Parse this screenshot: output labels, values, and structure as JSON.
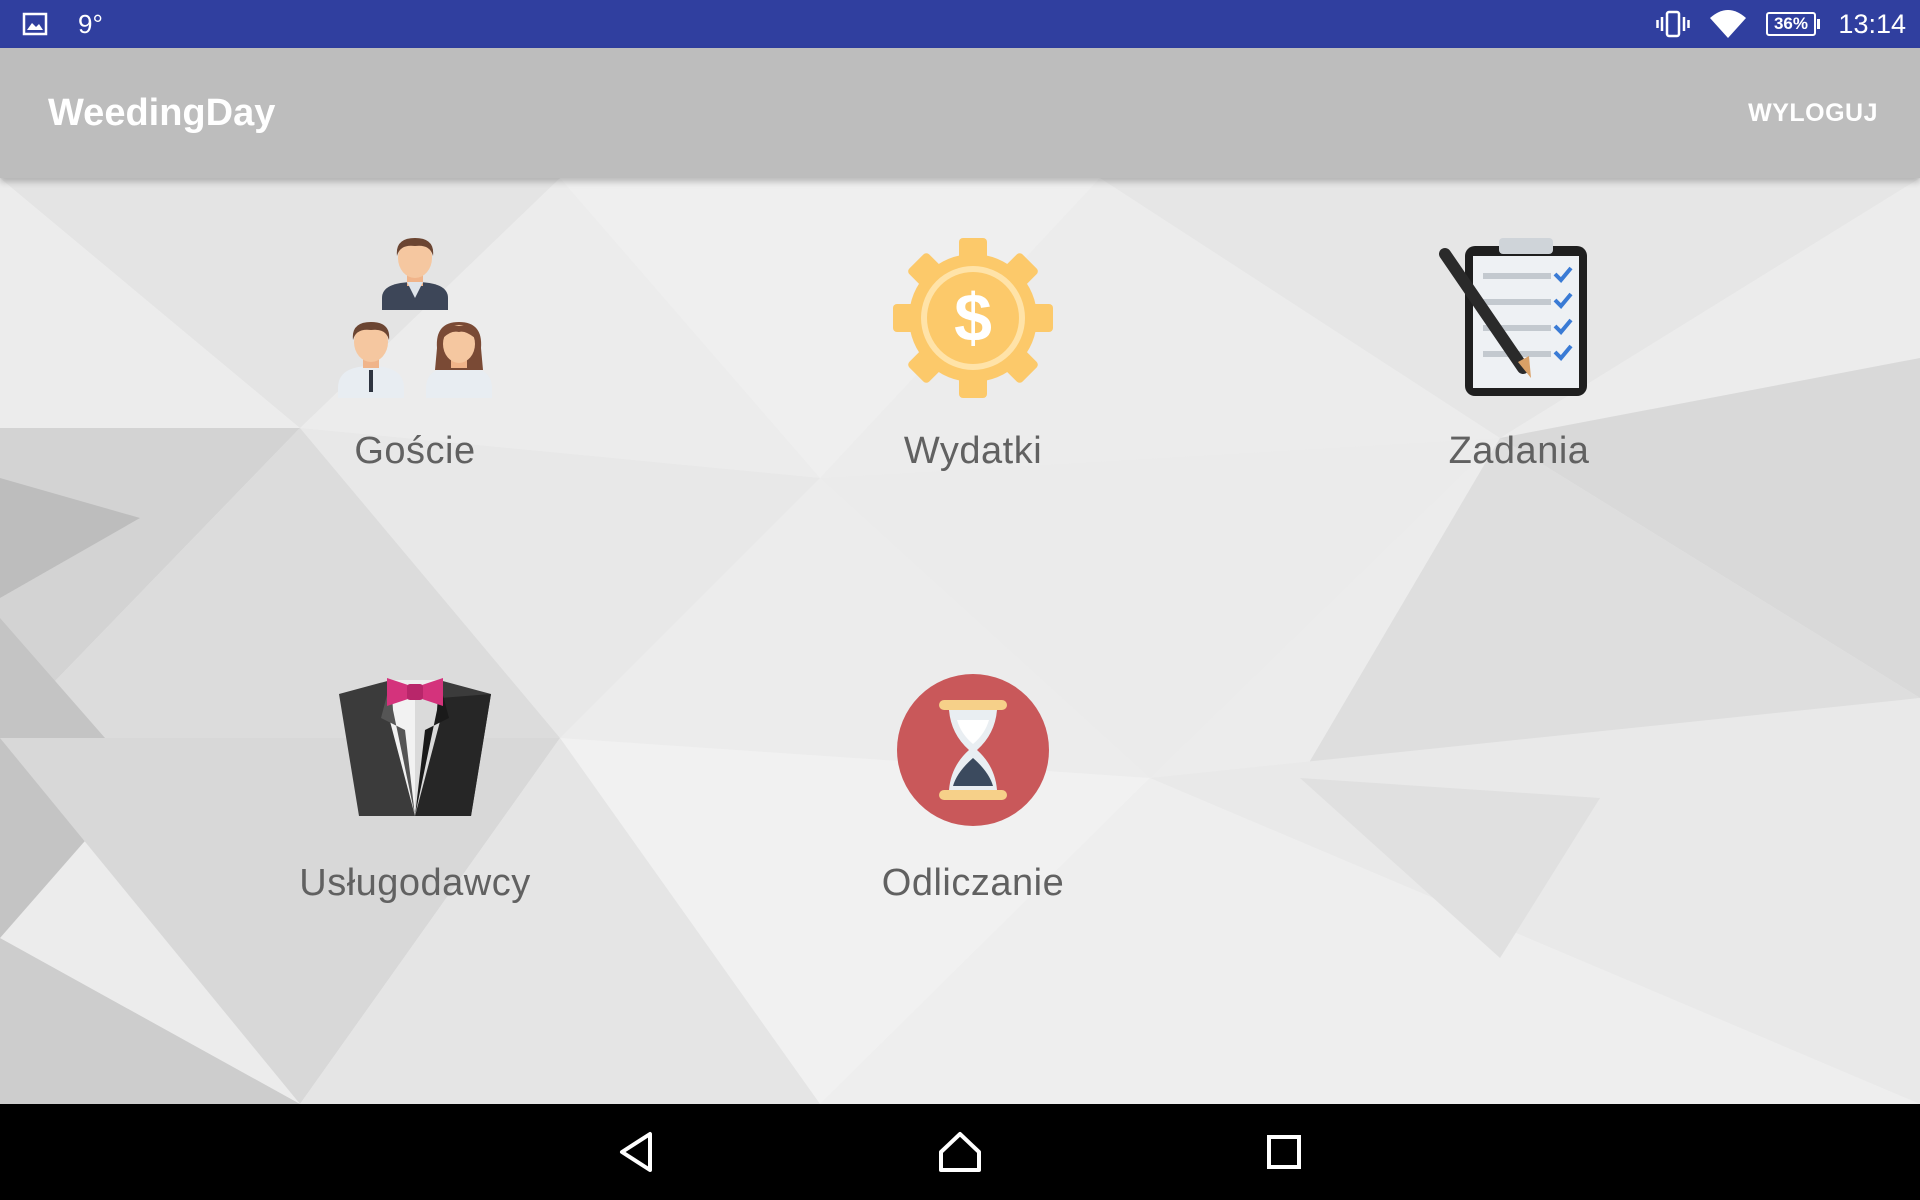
{
  "status_bar": {
    "temperature": "9°",
    "battery": "36%",
    "battery_level": 0.36,
    "time": "13:14",
    "icons": [
      "image-notification-icon",
      "vibrate-icon",
      "wifi-icon",
      "battery-icon"
    ]
  },
  "app_bar": {
    "title": "WeedingDay",
    "logout_label": "WYLOGUJ"
  },
  "menu": {
    "items": [
      {
        "label": "Goście",
        "icon": "guests-icon"
      },
      {
        "label": "Wydatki",
        "icon": "expenses-icon"
      },
      {
        "label": "Zadania",
        "icon": "tasks-icon"
      },
      {
        "label": "Usługodawcy",
        "icon": "tuxedo-icon"
      },
      {
        "label": "Odliczanie",
        "icon": "hourglass-icon"
      }
    ]
  },
  "nav_bar": {
    "icons": [
      "back-icon",
      "home-icon",
      "recents-icon"
    ]
  },
  "colors": {
    "status_bar": "#303f9f",
    "app_bar": "#bdbdbd",
    "label_text": "#616161",
    "dollar_gear": "#fcc96a",
    "hourglass_circle": "#c9585a",
    "bow_tie": "#d4337c"
  }
}
